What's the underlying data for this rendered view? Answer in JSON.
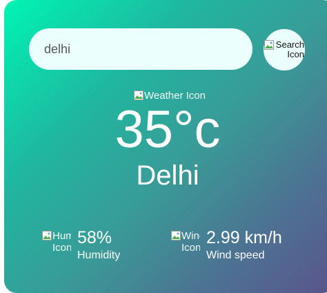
{
  "search": {
    "value": "delhi",
    "button_alt": "Search Icon"
  },
  "weather": {
    "icon_alt": "Weather Icon",
    "temperature": "35°c",
    "city": "Delhi"
  },
  "details": {
    "humidity": {
      "icon_alt": "Humidity Icon",
      "value": "58%",
      "label": "Humidity"
    },
    "wind": {
      "icon_alt": "Wind Icon",
      "value": "2.99 km/h",
      "label": "Wind speed"
    }
  },
  "icons": {
    "broken_image": "broken-image-icon"
  },
  "colors": {
    "gradient_start": "#00f5b4",
    "gradient_end": "#5a548c",
    "input_background": "#ebfffc"
  }
}
